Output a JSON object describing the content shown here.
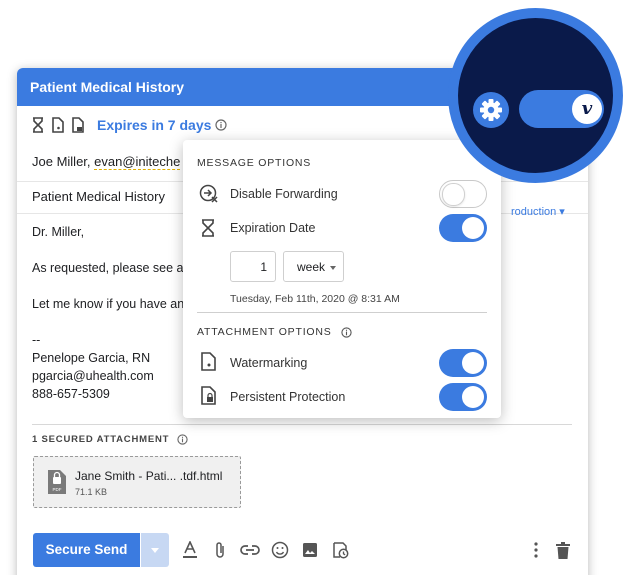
{
  "compose": {
    "title": "Patient Medical History",
    "expires_text": "Expires in 7 days",
    "to_text": "Joe Miller, ",
    "to_email": "evan@initeche",
    "subject": "Patient Medical History",
    "intro_link": "roduction ▾",
    "body": {
      "greeting": "Dr. Miller,",
      "line1": "As requested, please see at",
      "line2": "Let me know if you have an",
      "sig_dash": "--",
      "sig_name": "Penelope Garcia, RN",
      "sig_email": "pgarcia@uhealth.com",
      "sig_phone": "888-657-5309"
    },
    "attachments_label": "1 SECURED ATTACHMENT",
    "attachment": {
      "name": "Jane Smith - Pati... .tdf.html",
      "size": "71.1 KB",
      "type_label": "PDF"
    },
    "send_label": "Secure Send"
  },
  "popup": {
    "message_options_header": "MESSAGE OPTIONS",
    "disable_forwarding": {
      "label": "Disable Forwarding",
      "enabled": false
    },
    "expiration_date": {
      "label": "Expiration Date",
      "enabled": true
    },
    "expiration_amount": "1",
    "expiration_unit": "week",
    "expiration_date_text": "Tuesday, Feb 11th, 2020 @ 8:31 AM",
    "attachment_options_header": "ATTACHMENT OPTIONS",
    "watermarking": {
      "label": "Watermarking",
      "enabled": true
    },
    "persistent_protection": {
      "label": "Persistent Protection",
      "enabled": true
    }
  },
  "zoom": {
    "toggle_enabled": true,
    "logo_letter": "v"
  },
  "icons": [
    "hourglass-icon",
    "file-watermark-icon",
    "file-lock-icon",
    "info-icon",
    "no-forward-icon",
    "pdf-file-icon",
    "text-format-icon",
    "attach-icon",
    "link-icon",
    "emoji-icon",
    "image-icon",
    "schedule-icon",
    "more-vert-icon",
    "trash-icon",
    "gear-icon"
  ],
  "colors": {
    "accent": "#3b7be0",
    "dark_navy": "#0a1a4a",
    "link_underline": "#e0b000"
  }
}
